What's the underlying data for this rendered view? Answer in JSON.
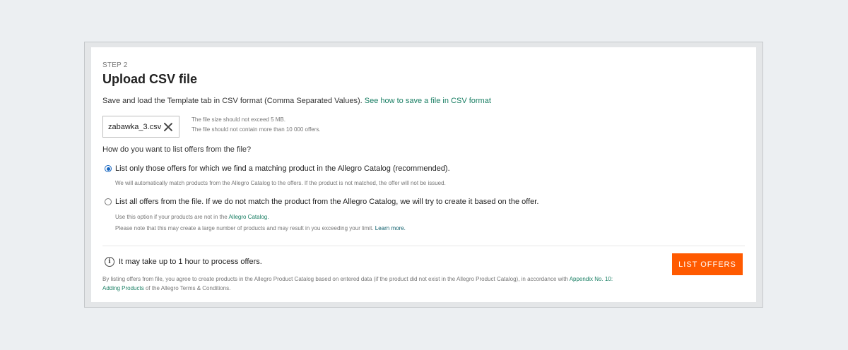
{
  "step": {
    "label": "STEP 2",
    "title": "Upload CSV file"
  },
  "description": {
    "text": "Save and load the Template tab in CSV format (Comma Separated Values).",
    "link": "See how to save a file in CSV format"
  },
  "file": {
    "name": "zabawka_3.csv",
    "hints": [
      "The file size should not exceed 5 MB.",
      "The file should not contain more than 10 000 offers."
    ]
  },
  "question": "How do you want to list offers from the file?",
  "options": [
    {
      "label": "List only those offers for which we find a matching product in the Allegro Catalog (recommended).",
      "checked": true,
      "hint": "We will automatically match products from the Allegro Catalog to the offers. If the product is not matched, the offer will not be issued."
    },
    {
      "label": "List all offers from the file. If we do not match the product from the Allegro Catalog, we will try to create it based on the offer.",
      "checked": false,
      "hint_prefix": "Use this option if your products are not in the",
      "hint_link": "Allegro Catalog.",
      "hint_line2": "Please note that this may create a large number of products and may result in you exceeding your limit.",
      "hint_line2_link": "Learn more."
    }
  ],
  "notice": "It may take up to 1 hour to process offers.",
  "terms": {
    "prefix": "By listing offers from file, you agree to create products in the Allegro Product Catalog based on entered data (if the product did not exist in the Allegro Product Catalog), in accordance with",
    "link": "Appendix No. 10: Adding Products",
    "suffix": "of the Allegro Terms & Conditions."
  },
  "button": {
    "label": "LIST OFFERS"
  },
  "colors": {
    "accent": "#ff5a00",
    "link": "#1a7f64",
    "radio": "#1565c0"
  }
}
